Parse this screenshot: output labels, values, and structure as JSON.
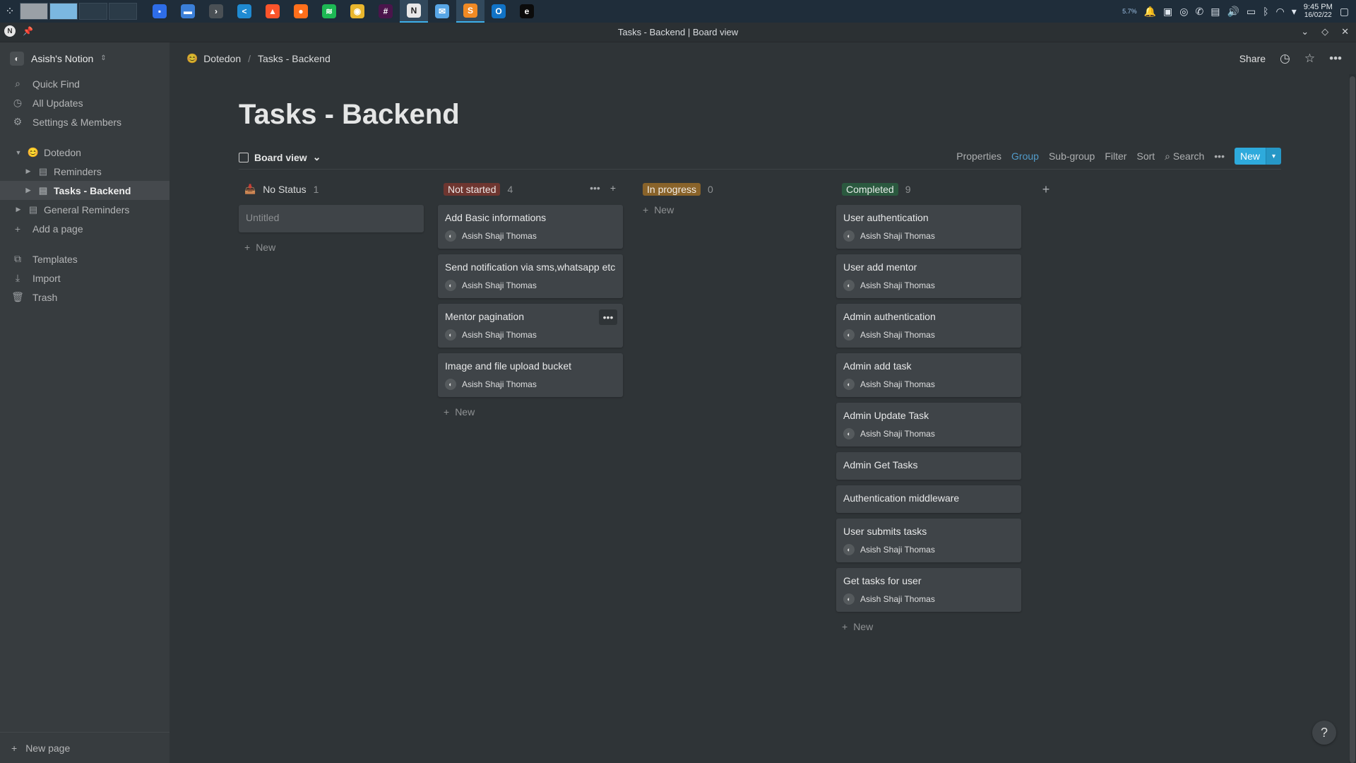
{
  "taskbar": {
    "apps": [
      {
        "icon": "calendar-app-icon",
        "color": "#2e6de8",
        "glyph": "▪"
      },
      {
        "icon": "file-manager-icon",
        "color": "#3b7fd8",
        "glyph": "▬"
      },
      {
        "icon": "terminal-icon",
        "color": "#4a5055",
        "glyph": "›"
      },
      {
        "icon": "vscode-icon",
        "color": "#1f8ad2",
        "glyph": "<"
      },
      {
        "icon": "brave-icon",
        "color": "#fb542b",
        "glyph": "▲"
      },
      {
        "icon": "firefox-icon",
        "color": "#ff6f1b",
        "glyph": "●"
      },
      {
        "icon": "spotify-icon",
        "color": "#1db954",
        "glyph": "≋"
      },
      {
        "icon": "chrome-icon",
        "color": "#e9b62d",
        "glyph": "◉"
      },
      {
        "icon": "slack-icon",
        "color": "#4a154b",
        "glyph": "#"
      },
      {
        "icon": "notion-icon",
        "color": "#e8e8e8",
        "glyph": "N"
      },
      {
        "icon": "mail-icon",
        "color": "#58a6e6",
        "glyph": "✉"
      },
      {
        "icon": "sublime-icon",
        "color": "#f08a24",
        "glyph": "S"
      },
      {
        "icon": "outlook-icon",
        "color": "#1173c6",
        "glyph": "O"
      },
      {
        "icon": "evernote-icon",
        "color": "#0b0b0b",
        "glyph": "e"
      }
    ],
    "tray": {
      "bluetooth_battery": "5.7%",
      "time": "9:45 PM",
      "date": "16/02/22"
    }
  },
  "window": {
    "title": "Tasks - Backend  |  Board view",
    "app_badge": "N"
  },
  "sidebar": {
    "workspace": "Asish's Notion",
    "nav": [
      {
        "label": "Quick Find",
        "icon": "search-icon",
        "glyph": "⌕"
      },
      {
        "label": "All Updates",
        "icon": "clock-icon",
        "glyph": "◷"
      },
      {
        "label": "Settings & Members",
        "icon": "gear-icon",
        "glyph": "⚙"
      }
    ],
    "tree": [
      {
        "label": "Dotedon",
        "icon": "emoji-icon"
      },
      {
        "label": "Reminders",
        "icon": "page-icon"
      },
      {
        "label": "Tasks - Backend",
        "icon": "page-icon"
      },
      {
        "label": "General Reminders",
        "icon": "page-icon"
      }
    ],
    "add_page": "Add a page",
    "bottom": [
      {
        "label": "Templates",
        "icon": "templates-icon",
        "glyph": "⧉"
      },
      {
        "label": "Import",
        "icon": "import-icon",
        "glyph": "⤓"
      },
      {
        "label": "Trash",
        "icon": "trash-icon",
        "glyph": "🗑"
      }
    ],
    "new_page": "New page"
  },
  "topbar": {
    "breadcrumb": [
      "Dotedon",
      "Tasks - Backend"
    ],
    "share": "Share"
  },
  "page": {
    "title": "Tasks - Backend",
    "view": "Board view",
    "actions": [
      "Properties",
      "Group",
      "Sub-group",
      "Filter",
      "Sort",
      "Search"
    ],
    "new": "New"
  },
  "board": {
    "new_label": "New",
    "columns": [
      {
        "name": "No Status",
        "count": "1",
        "tag_color": "",
        "cards": [
          {
            "title": "Untitled",
            "person": ""
          }
        ]
      },
      {
        "name": "Not started",
        "count": "4",
        "tag_color": "#6e3630",
        "cards": [
          {
            "title": "Add Basic informations",
            "person": "Asish Shaji Thomas"
          },
          {
            "title": "Send notification via sms,whatsapp etc",
            "person": "Asish Shaji Thomas"
          },
          {
            "title": "Mentor pagination",
            "person": "Asish Shaji Thomas"
          },
          {
            "title": "Image and file upload bucket",
            "person": "Asish Shaji Thomas"
          }
        ]
      },
      {
        "name": "In progress",
        "count": "0",
        "tag_color": "#89632a",
        "cards": []
      },
      {
        "name": "Completed",
        "count": "9",
        "tag_color": "#2b593f",
        "cards": [
          {
            "title": "User authentication",
            "person": "Asish Shaji Thomas"
          },
          {
            "title": "User add mentor",
            "person": "Asish Shaji Thomas"
          },
          {
            "title": "Admin authentication",
            "person": "Asish Shaji Thomas"
          },
          {
            "title": "Admin add task",
            "person": "Asish Shaji Thomas"
          },
          {
            "title": "Admin Update Task",
            "person": "Asish Shaji Thomas"
          },
          {
            "title": "Admin Get Tasks",
            "person": ""
          },
          {
            "title": "Authentication middleware",
            "person": ""
          },
          {
            "title": "User submits tasks",
            "person": "Asish Shaji Thomas"
          },
          {
            "title": "Get tasks for user",
            "person": "Asish Shaji Thomas"
          }
        ]
      }
    ]
  },
  "help": "?"
}
